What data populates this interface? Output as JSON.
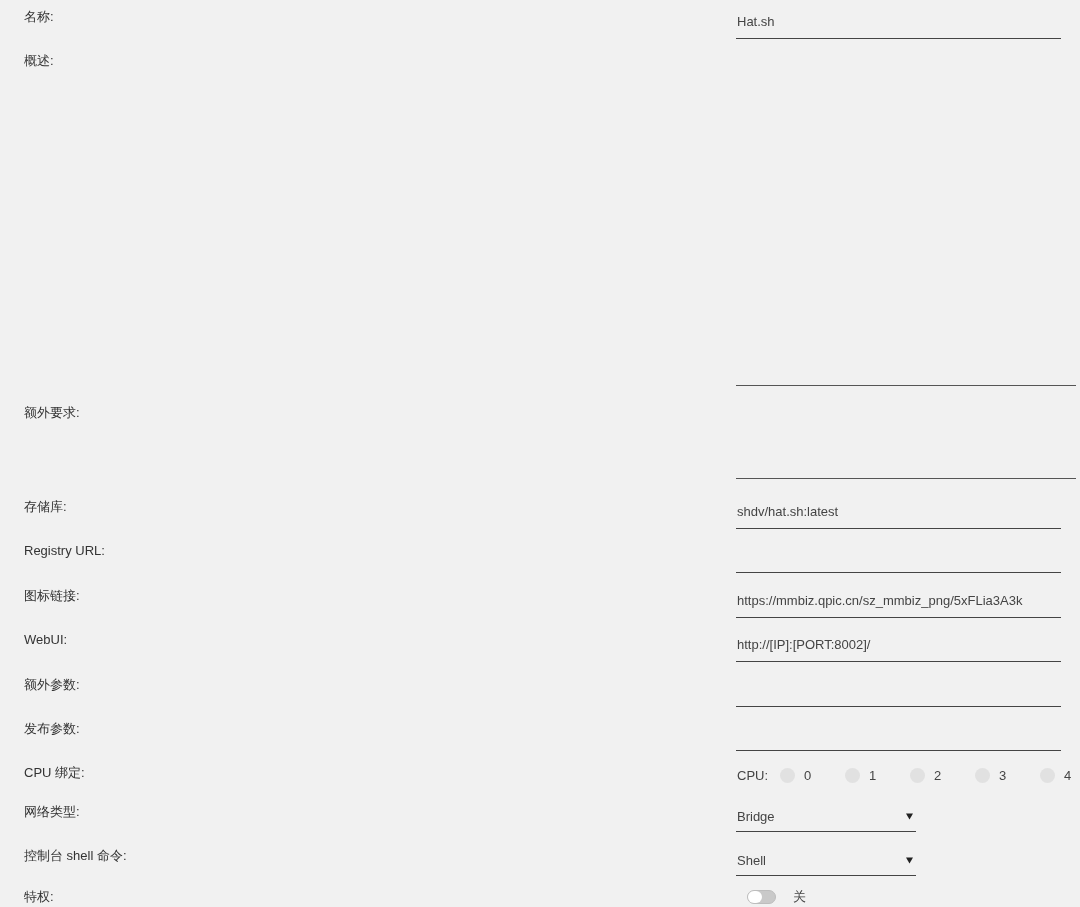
{
  "form": {
    "fields": [
      {
        "label": "名称:",
        "kind": "text",
        "value": "Hat.sh"
      },
      {
        "label": "概述:",
        "kind": "textarea"
      },
      {
        "label": "额外要求:",
        "kind": "textarea"
      },
      {
        "label": "存储库:",
        "kind": "text",
        "value": "shdv/hat.sh:latest"
      },
      {
        "label": "Registry URL:",
        "kind": "text"
      },
      {
        "label": "图标链接:",
        "kind": "text",
        "value": "https://mmbiz.qpic.cn/sz_mmbiz_png/5xFLia3A3k"
      },
      {
        "label": "WebUI:",
        "kind": "text",
        "value": "http://[IP]:[PORT:8002]/"
      },
      {
        "label": "额外参数:",
        "kind": "text"
      },
      {
        "label": "发布参数:",
        "kind": "text"
      },
      {
        "label": "CPU 绑定:",
        "kind": "cpu",
        "prefix": "CPU:",
        "options": [
          {
            "label": "0",
            "checked": false
          },
          {
            "label": "1",
            "checked": false
          },
          {
            "label": "2",
            "checked": false
          },
          {
            "label": "3",
            "checked": false
          },
          {
            "label": "4",
            "checked": false
          }
        ]
      },
      {
        "label": "网络类型:",
        "kind": "select",
        "value": "Bridge"
      },
      {
        "label": "控制台 shell 命令:",
        "kind": "select",
        "value": "Shell"
      },
      {
        "label": "特权:",
        "kind": "toggle",
        "on": false,
        "state_label": "关"
      }
    ]
  }
}
